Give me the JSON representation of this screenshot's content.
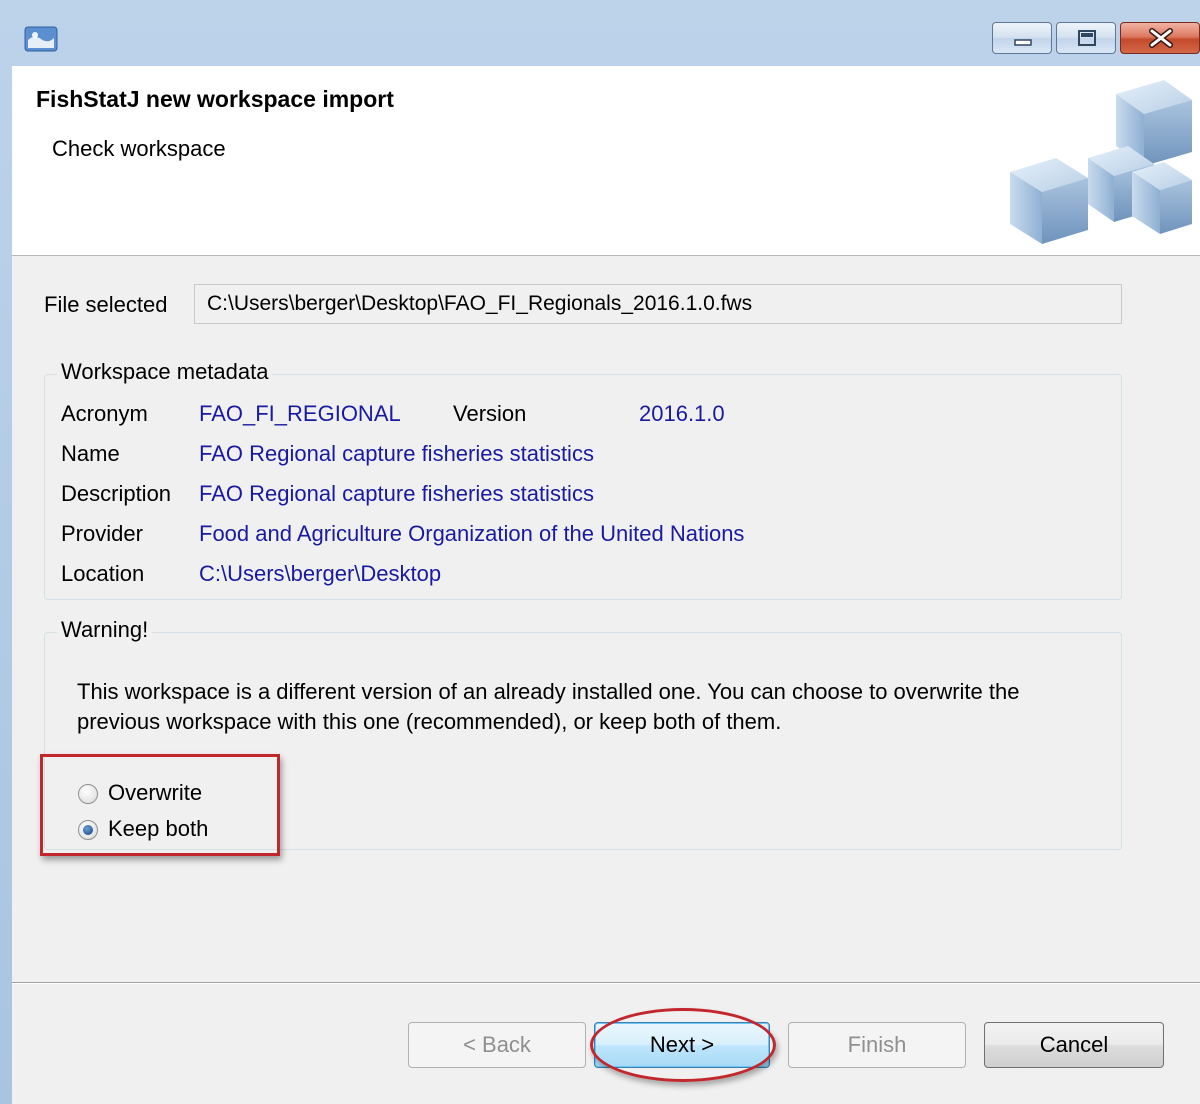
{
  "window": {
    "controls": {
      "minimize_icon": "minimize-icon",
      "maximize_icon": "maximize-icon",
      "close_icon": "close-icon"
    }
  },
  "header": {
    "title": "FishStatJ new workspace import",
    "subtitle": "Check workspace"
  },
  "file": {
    "label": "File selected",
    "value": "C:\\Users\\berger\\Desktop\\FAO_FI_Regionals_2016.1.0.fws"
  },
  "metadata": {
    "legend": "Workspace metadata",
    "acronym_label": "Acronym",
    "acronym_value": "FAO_FI_REGIONAL",
    "version_label": "Version",
    "version_value": "2016.1.0",
    "name_label": "Name",
    "name_value": "FAO Regional capture fisheries statistics",
    "description_label": "Description",
    "description_value": "FAO Regional capture fisheries statistics",
    "provider_label": "Provider",
    "provider_value": "Food and Agriculture Organization of the United Nations",
    "location_label": "Location",
    "location_value": "C:\\Users\\berger\\Desktop"
  },
  "warning": {
    "legend": "Warning!",
    "line1": "This workspace is a different version of an already installed one. You can choose to overwrite the",
    "line2": "previous workspace with this one (recommended), or keep both of them.",
    "options": [
      {
        "label": "Overwrite",
        "selected": false
      },
      {
        "label": "Keep both",
        "selected": true
      }
    ]
  },
  "buttons": {
    "back": "< Back",
    "next": "Next >",
    "finish": "Finish",
    "cancel": "Cancel"
  },
  "colors": {
    "highlight": "#c1272d",
    "value_text": "#1a1aa0"
  }
}
